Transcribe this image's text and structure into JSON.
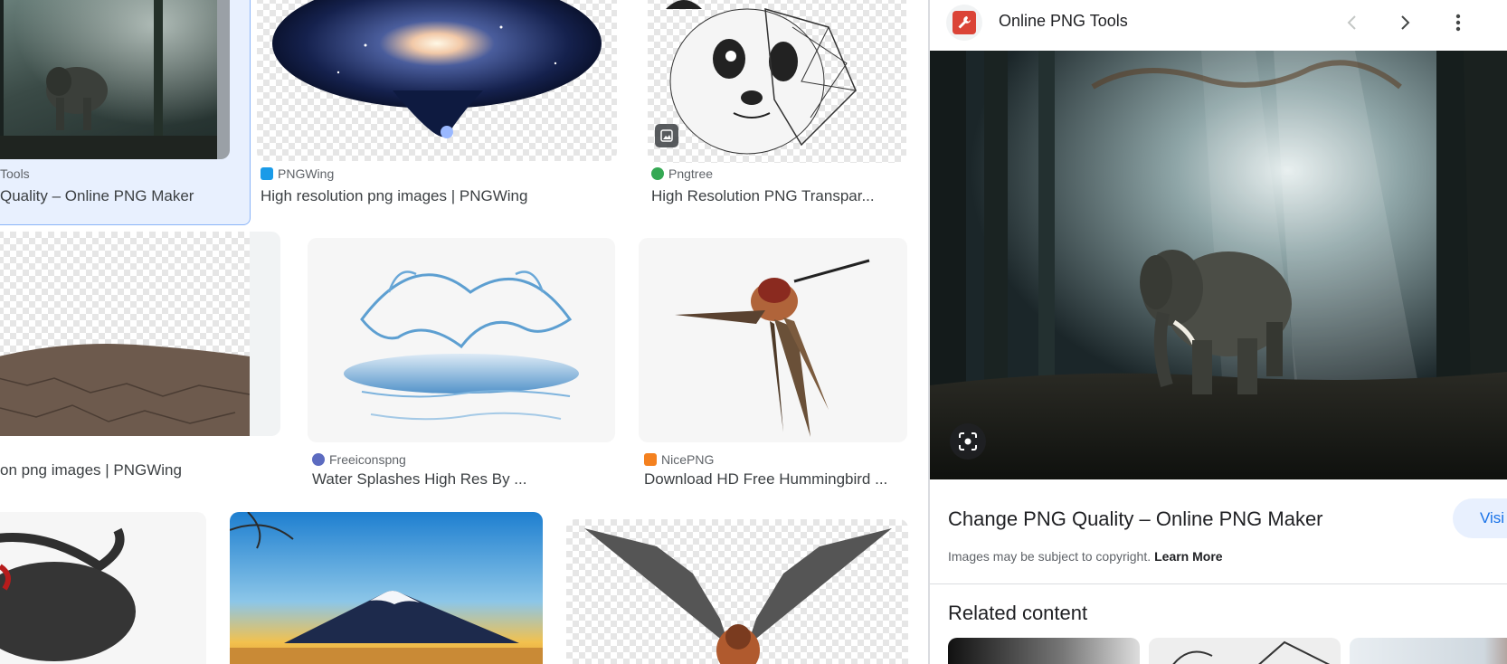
{
  "results": [
    {
      "source": "Tools",
      "title": "Quality – Online PNG Maker",
      "selected": true
    },
    {
      "source": "PNGWing",
      "title": "High resolution png images | PNGWing"
    },
    {
      "source": "Pngtree",
      "title": "High Resolution PNG Transpar..."
    },
    {
      "source": "",
      "title": "on png images | PNGWing"
    },
    {
      "source": "Freeiconspng",
      "title": "Water Splashes High Res By ..."
    },
    {
      "source": "NicePNG",
      "title": "Download HD Free Hummingbird ..."
    }
  ],
  "panel": {
    "site_name": "Online PNG Tools",
    "title": "Change PNG Quality – Online PNG Maker",
    "visit_label": "Visi",
    "copyright_text": "Images may be subject to copyright.",
    "learn_more": "Learn More",
    "related_heading": "Related content"
  },
  "colors": {
    "accent": "#1a73e8",
    "selected_bg": "#e8f0fe",
    "pngwing": "#1a9be8",
    "pngtree": "#34a853",
    "freeiconspng": "#5c6bc0",
    "nicepng": "#f4811f",
    "onlinepngtools": "#db4437"
  },
  "icons": [
    "wrench-icon",
    "chevron-left-icon",
    "chevron-right-icon",
    "more-vert-icon",
    "lens-icon",
    "image-badge-icon"
  ]
}
